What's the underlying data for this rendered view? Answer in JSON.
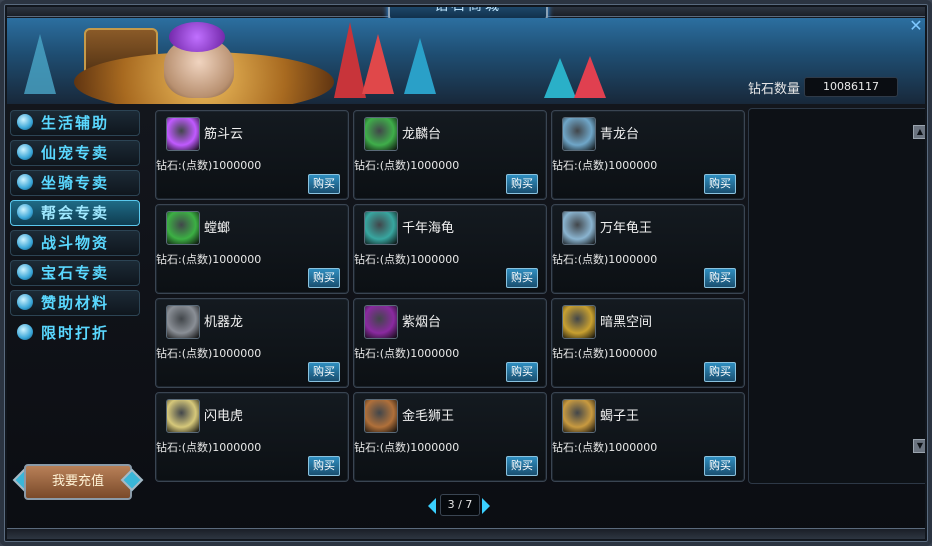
{
  "title": "钻石商城",
  "balance": {
    "label": "钻石数量",
    "value": "10086117"
  },
  "categories": [
    {
      "label": "生活辅助",
      "icon": "scroll-icon"
    },
    {
      "label": "仙宠专卖",
      "icon": "paw-icon"
    },
    {
      "label": "坐骑专卖",
      "icon": "horse-icon"
    },
    {
      "label": "帮会专卖",
      "icon": "flag-icon",
      "active": true
    },
    {
      "label": "战斗物资",
      "icon": "crate-icon"
    },
    {
      "label": "宝石专卖",
      "icon": "gem-icon"
    },
    {
      "label": "赞助材料",
      "icon": "ore-icon"
    },
    {
      "label": "限时打折",
      "icon": "megaphone-icon"
    }
  ],
  "recharge_label": "我要充值",
  "items": [
    {
      "name": "筋斗云",
      "price": "钻石:(点数)1000000",
      "buy": "购买",
      "thumb": "#c05aff"
    },
    {
      "name": "龙麟台",
      "price": "钻石:(点数)1000000",
      "buy": "购买",
      "thumb": "#3fae4a"
    },
    {
      "name": "青龙台",
      "price": "钻石:(点数)1000000",
      "buy": "购买",
      "thumb": "#6fa6c8"
    },
    {
      "name": "螳螂",
      "price": "钻石:(点数)1000000",
      "buy": "购买",
      "thumb": "#3cb044"
    },
    {
      "name": "千年海龟",
      "price": "钻石:(点数)1000000",
      "buy": "购买",
      "thumb": "#38a6a0"
    },
    {
      "name": "万年龟王",
      "price": "钻石:(点数)1000000",
      "buy": "购买",
      "thumb": "#8ab4d0"
    },
    {
      "name": "机器龙",
      "price": "钻石:(点数)1000000",
      "buy": "购买",
      "thumb": "#8a8f96"
    },
    {
      "name": "紫烟台",
      "price": "钻石:(点数)1000000",
      "buy": "购买",
      "thumb": "#8a2aa0"
    },
    {
      "name": "暗黑空间",
      "price": "钻石:(点数)1000000",
      "buy": "购买",
      "thumb": "#c8a030"
    },
    {
      "name": "闪电虎",
      "price": "钻石:(点数)1000000",
      "buy": "购买",
      "thumb": "#d6c87a"
    },
    {
      "name": "金毛狮王",
      "price": "钻石:(点数)1000000",
      "buy": "购买",
      "thumb": "#b0703a"
    },
    {
      "name": "蝎子王",
      "price": "钻石:(点数)1000000",
      "buy": "购买",
      "thumb": "#c89a40"
    }
  ],
  "pager": {
    "current": "3",
    "total": "7",
    "text": "3 / 7"
  },
  "colors": {
    "accent": "#3ad0ff",
    "buy_button": "#2f8ec0"
  }
}
